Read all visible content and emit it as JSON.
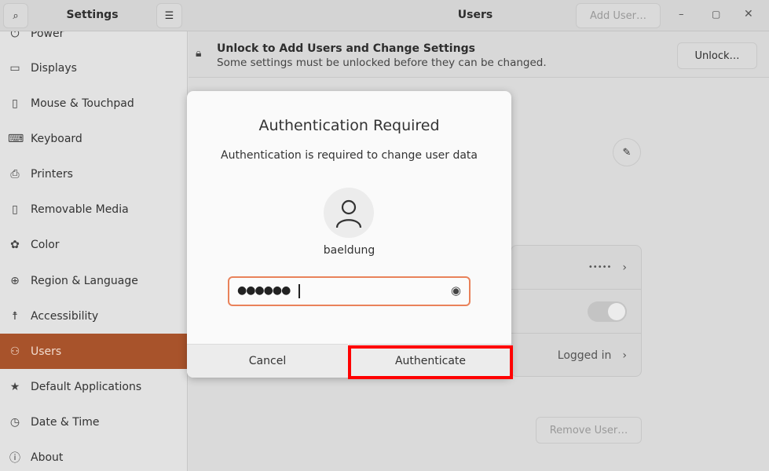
{
  "header": {
    "app_title": "Settings",
    "page_title": "Users",
    "add_user_label": "Add User…"
  },
  "sidebar": {
    "items": [
      {
        "label": "Power",
        "icon": "power-icon"
      },
      {
        "label": "Displays",
        "icon": "display-icon"
      },
      {
        "label": "Mouse & Touchpad",
        "icon": "mouse-icon"
      },
      {
        "label": "Keyboard",
        "icon": "keyboard-icon"
      },
      {
        "label": "Printers",
        "icon": "printer-icon"
      },
      {
        "label": "Removable Media",
        "icon": "removable-media-icon"
      },
      {
        "label": "Color",
        "icon": "color-icon"
      },
      {
        "label": "Region & Language",
        "icon": "globe-icon"
      },
      {
        "label": "Accessibility",
        "icon": "accessibility-icon"
      },
      {
        "label": "Users",
        "icon": "users-icon",
        "active": true
      },
      {
        "label": "Default Applications",
        "icon": "star-icon"
      },
      {
        "label": "Date & Time",
        "icon": "clock-icon"
      },
      {
        "label": "About",
        "icon": "info-icon"
      }
    ]
  },
  "banner": {
    "title": "Unlock to Add Users and Change Settings",
    "subtitle": "Some settings must be unlocked before they can be changed.",
    "unlock_label": "Unlock…"
  },
  "account": {
    "password_value": "•••••",
    "logged_in_value": "Logged in",
    "remove_user_label": "Remove User…",
    "autologin_toggle": false
  },
  "dialog": {
    "title": "Authentication Required",
    "message": "Authentication is required to change user data",
    "username": "baeldung",
    "password_masked": "●●●●●●",
    "cancel_label": "Cancel",
    "authenticate_label": "Authenticate",
    "highlight_color": "#ff0000",
    "focus_color": "#e9825a"
  }
}
